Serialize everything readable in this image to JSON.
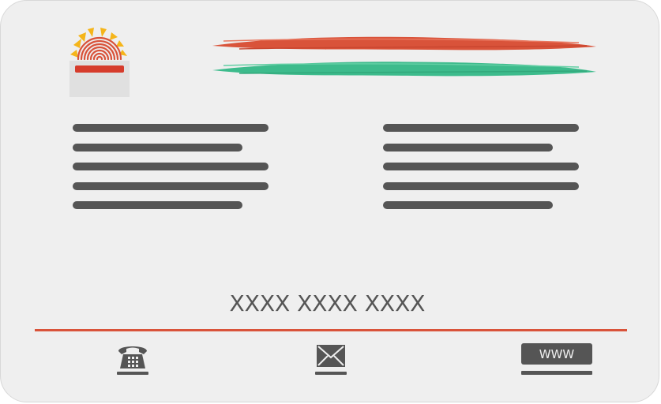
{
  "card": {
    "id_number": "XXXX XXXX XXXX",
    "left_lines": [
      "full",
      "short",
      "full",
      "full",
      "short"
    ],
    "right_lines": [
      "full",
      "short",
      "full",
      "full",
      "short"
    ]
  },
  "colors": {
    "background": "#efefef",
    "text_lines": "#555555",
    "saffron": "#d9533a",
    "green": "#3dbb8c",
    "sun_yellow": "#f5b51a",
    "divider": "#d9533a"
  },
  "footer": {
    "phone_icon": "telephone-icon",
    "mail_icon": "envelope-icon",
    "web_label": "WWW"
  }
}
